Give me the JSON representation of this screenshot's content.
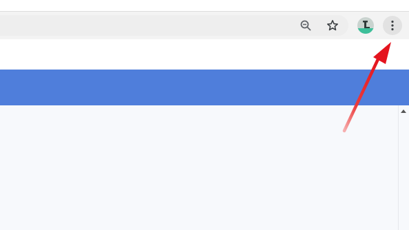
{
  "toolbar": {
    "zoom_icon": "zoom-out-icon",
    "star_icon": "bookmark-star-icon",
    "avatar_icon": "profile-avatar-icon",
    "menu_icon": "vertical-dots-menu-icon"
  },
  "colors": {
    "toolbar_bg": "#f3f3f3",
    "banner_blue": "#4f7edb",
    "content_bg": "#f7f9fc",
    "annotation_arrow": "#e8202a"
  }
}
